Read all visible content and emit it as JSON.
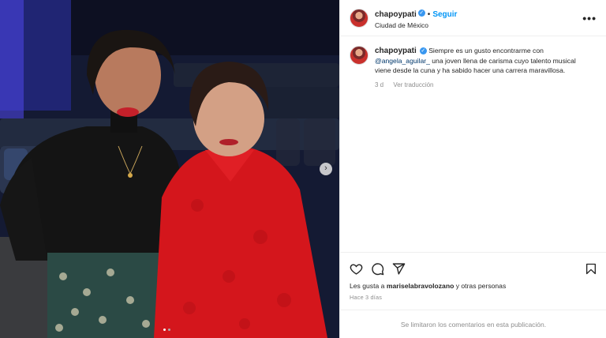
{
  "post": {
    "username": "chapoypati",
    "follow_label": "Seguir",
    "location": "Ciudad de México",
    "more_label": "•••",
    "caption_pre": "Siempre es un gusto encontrarme con",
    "caption_mention": "@angela_aguilar_",
    "caption_post": "una joven llena de carisma cuyo talento musical viene desde la cuna y ha sabido hacer una carrera maravillosa.",
    "caption_age": "3 d",
    "translate_label": "Ver traducción",
    "likes_prefix": "Les gusta a",
    "likes_user": "mariselabravolozano",
    "likes_suffix": "y otras personas",
    "posted_ago": "Hace 3 días",
    "comments_disabled": "Se limitaron los comentarios en esta publicación.",
    "carousel_count": 2,
    "carousel_active": 0
  },
  "colors": {
    "accent": "#0095f6",
    "verified": "#3897f0",
    "muted": "#8e8e8e"
  },
  "icons": [
    "verified-badge-icon",
    "more-options-icon",
    "heart-icon",
    "comment-icon",
    "share-icon",
    "bookmark-icon",
    "chevron-right-icon"
  ]
}
